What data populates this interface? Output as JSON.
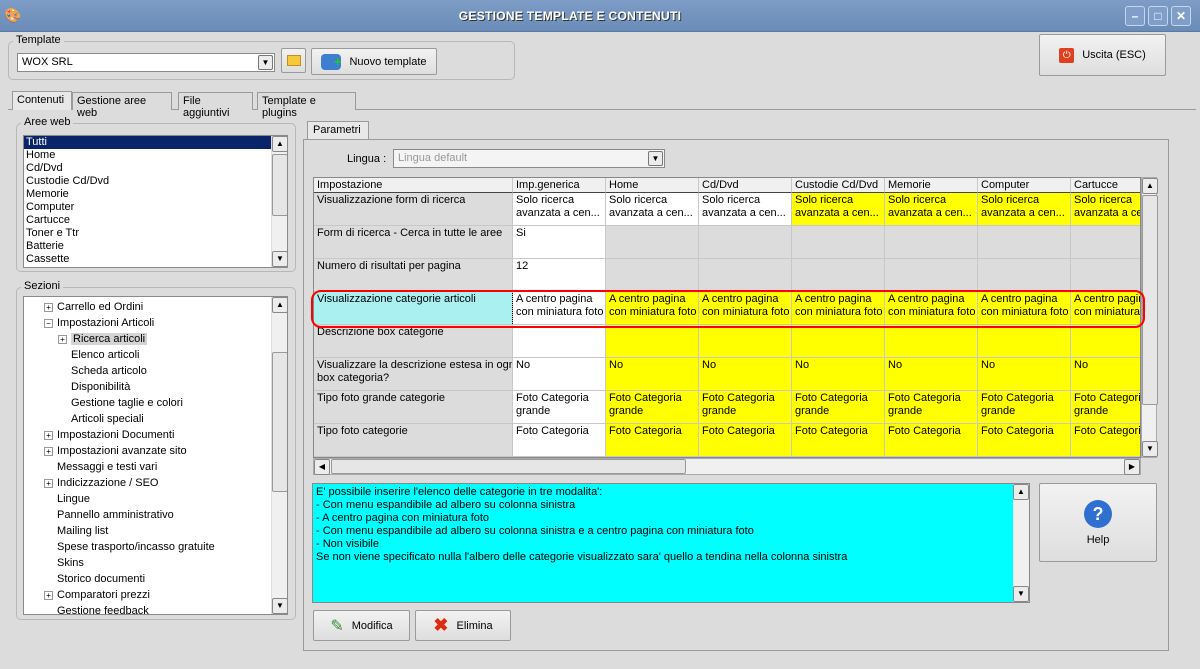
{
  "window": {
    "title": "GESTIONE TEMPLATE E CONTENUTI",
    "minimize": "–",
    "maximize": "□",
    "close": "✕"
  },
  "template": {
    "group_label": "Template",
    "selected": "WOX SRL",
    "new_button": "Nuovo template"
  },
  "exit_button": "Uscita (ESC)",
  "tabs": [
    "Contenuti",
    "Gestione aree web",
    "File aggiuntivi",
    "Template e plugins"
  ],
  "aree_web": {
    "label": "Aree web",
    "items": [
      "Tutti",
      "Home",
      "Cd/Dvd",
      "Custodie Cd/Dvd",
      "Memorie",
      "Computer",
      "Cartucce",
      "Toner e Ttr",
      "Batterie",
      "Cassette"
    ],
    "selected": 0
  },
  "sezioni": {
    "label": "Sezioni",
    "items": [
      {
        "label": "Carrello ed Ordini",
        "level": 0,
        "toggle": "+"
      },
      {
        "label": "Impostazioni Articoli",
        "level": 0,
        "toggle": "-"
      },
      {
        "label": "Ricerca articoli",
        "level": 1,
        "toggle": "+",
        "selected": true
      },
      {
        "label": "Elenco articoli",
        "level": 1
      },
      {
        "label": "Scheda articolo",
        "level": 1
      },
      {
        "label": "Disponibilità",
        "level": 1
      },
      {
        "label": "Gestione taglie e colori",
        "level": 1
      },
      {
        "label": "Articoli speciali",
        "level": 1
      },
      {
        "label": "Impostazioni Documenti",
        "level": 0,
        "toggle": "+"
      },
      {
        "label": "Impostazioni avanzate sito",
        "level": 0,
        "toggle": "+"
      },
      {
        "label": "Messaggi e testi vari",
        "level": 0
      },
      {
        "label": "Indicizzazione / SEO",
        "level": 0,
        "toggle": "+"
      },
      {
        "label": "Lingue",
        "level": 0
      },
      {
        "label": "Pannello amministrativo",
        "level": 0
      },
      {
        "label": "Mailing list",
        "level": 0
      },
      {
        "label": "Spese trasporto/incasso gratuite",
        "level": 0
      },
      {
        "label": "Skins",
        "level": 0
      },
      {
        "label": "Storico documenti",
        "level": 0
      },
      {
        "label": "Comparatori prezzi",
        "level": 0,
        "toggle": "+"
      },
      {
        "label": "Gestione feedback",
        "level": 0
      }
    ]
  },
  "parametri": {
    "tab": "Parametri",
    "lingua_label": "Lingua :",
    "lingua_value": "Lingua default"
  },
  "colors": {
    "yellow": "#ffff00",
    "white": "#ffffff",
    "gray": "#dcdcdc",
    "cyan": "#aaf0f0",
    "highlight_ring": "#ff0000",
    "description_bg": "#00ffff"
  },
  "grid": {
    "columns": [
      "Impostazione",
      "Imp.generica",
      "Home",
      "Cd/Dvd",
      "Custodie Cd/Dvd",
      "Memorie",
      "Computer",
      "Cartucce"
    ],
    "rows": [
      {
        "label": "Visualizzazione form di ricerca",
        "values": [
          "Solo ricerca\navanzata a cen...",
          "Solo ricerca\navanzata a cen...",
          "Solo ricerca\navanzata a cen...",
          "Solo ricerca\navanzata a cen...",
          "Solo ricerca\navanzata a cen...",
          "Solo ricerca\navanzata a cen...",
          "Solo ricerca\navanzata a ce"
        ],
        "fills": [
          "white",
          "white",
          "white",
          "yellow",
          "yellow",
          "yellow",
          "yellow"
        ]
      },
      {
        "label": "Form di ricerca - Cerca in tutte le aree",
        "values": [
          "Si",
          "",
          "",
          "",
          "",
          "",
          ""
        ],
        "fills": [
          "white",
          "gray",
          "gray",
          "gray",
          "gray",
          "gray",
          "gray"
        ]
      },
      {
        "label": "Numero di risultati per pagina",
        "values": [
          "12",
          "",
          "",
          "",
          "",
          "",
          ""
        ],
        "fills": [
          "white",
          "gray",
          "gray",
          "gray",
          "gray",
          "gray",
          "gray"
        ]
      },
      {
        "label": "Visualizzazione categorie articoli",
        "values": [
          "A centro pagina\ncon miniatura foto",
          "A centro pagina\ncon miniatura foto",
          "A centro pagina\ncon miniatura foto",
          "A centro pagina\ncon miniatura foto",
          "A centro pagina\ncon miniatura foto",
          "A centro pagina\ncon miniatura foto",
          "A centro pagina\ncon miniatura"
        ],
        "fills": [
          "white",
          "yellow",
          "yellow",
          "yellow",
          "yellow",
          "yellow",
          "yellow"
        ],
        "selected": true
      },
      {
        "label": "Descrizione box categorie",
        "values": [
          "",
          "",
          "",
          "",
          "",
          "",
          ""
        ],
        "fills": [
          "white",
          "yellow",
          "yellow",
          "yellow",
          "yellow",
          "yellow",
          "yellow"
        ]
      },
      {
        "label": "Visualizzare la descrizione estesa in ogni\nbox categoria?",
        "values": [
          "No",
          "No",
          "No",
          "No",
          "No",
          "No",
          "No"
        ],
        "fills": [
          "white",
          "yellow",
          "yellow",
          "yellow",
          "yellow",
          "yellow",
          "yellow"
        ]
      },
      {
        "label": "Tipo foto grande categorie",
        "values": [
          "Foto Categoria\ngrande",
          "Foto Categoria\ngrande",
          "Foto Categoria\ngrande",
          "Foto Categoria\ngrande",
          "Foto Categoria\ngrande",
          "Foto Categoria\ngrande",
          "Foto Categori\ngrande"
        ],
        "fills": [
          "white",
          "yellow",
          "yellow",
          "yellow",
          "yellow",
          "yellow",
          "yellow"
        ]
      },
      {
        "label": "Tipo foto categorie",
        "values": [
          "Foto Categoria",
          "Foto Categoria",
          "Foto Categoria",
          "Foto Categoria",
          "Foto Categoria",
          "Foto Categoria",
          "Foto Categori"
        ],
        "fills": [
          "white",
          "yellow",
          "yellow",
          "yellow",
          "yellow",
          "yellow",
          "yellow"
        ]
      }
    ]
  },
  "description": "E' possibile inserire l'elenco delle categorie in tre modalita':\n- Con menu espandibile ad albero su colonna sinistra\n- A centro pagina con miniatura foto\n- Con menu espandibile ad albero su colonna sinistra e a centro pagina con miniatura foto\n- Non visibile\nSe non viene specificato nulla l'albero delle categorie visualizzato sara' quello a tendina nella colonna sinistra",
  "buttons": {
    "help": "Help",
    "modifica": "Modifica",
    "elimina": "Elimina"
  }
}
